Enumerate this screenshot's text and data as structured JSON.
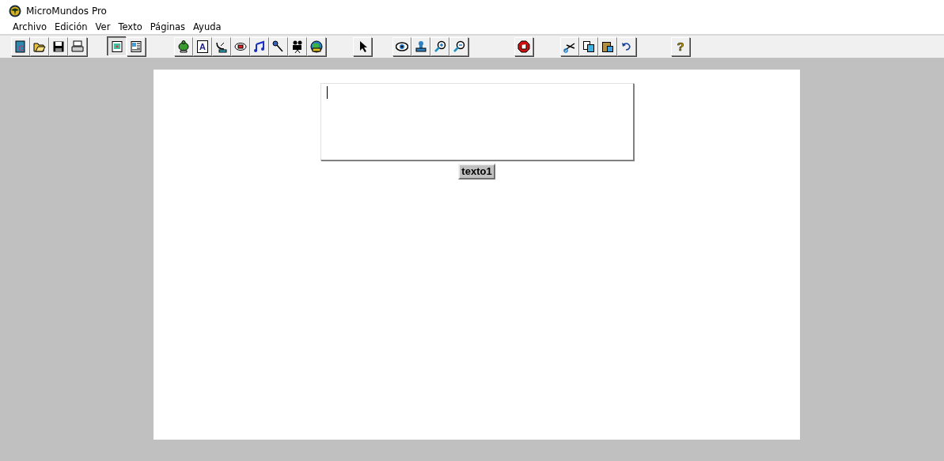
{
  "window": {
    "title": "MicroMundos Pro"
  },
  "menu": [
    "Archivo",
    "Edición",
    "Ver",
    "Texto",
    "Páginas",
    "Ayuda"
  ],
  "toolbar": [
    [
      {
        "kind": "new",
        "selected": false
      },
      {
        "kind": "open",
        "selected": false
      },
      {
        "kind": "save",
        "selected": false
      },
      {
        "kind": "print",
        "selected": false
      }
    ],
    [
      {
        "kind": "page",
        "selected": true
      },
      {
        "kind": "procedures",
        "selected": false
      }
    ],
    [
      {
        "kind": "turtle",
        "selected": false
      },
      {
        "kind": "text",
        "glyph": "A",
        "selected": false
      },
      {
        "kind": "dish",
        "selected": false
      },
      {
        "kind": "button",
        "selected": false
      },
      {
        "kind": "music",
        "selected": false
      },
      {
        "kind": "mic",
        "selected": false
      },
      {
        "kind": "video",
        "selected": false
      },
      {
        "kind": "globe",
        "selected": false
      }
    ],
    [
      {
        "kind": "pointer",
        "selected": false
      }
    ],
    [
      {
        "kind": "eye",
        "selected": false
      },
      {
        "kind": "stamp",
        "selected": false
      },
      {
        "kind": "zoomin",
        "selected": false
      },
      {
        "kind": "zoomout",
        "selected": false
      }
    ],
    [
      {
        "kind": "stop",
        "selected": false
      }
    ],
    [
      {
        "kind": "scissors",
        "selected": false
      },
      {
        "kind": "copy",
        "selected": false
      },
      {
        "kind": "paste",
        "selected": false
      },
      {
        "kind": "undo",
        "selected": false
      }
    ],
    [
      {
        "kind": "help",
        "glyph": "?",
        "selected": false
      }
    ]
  ],
  "page": {
    "textbox": {
      "label": "texto1"
    }
  }
}
